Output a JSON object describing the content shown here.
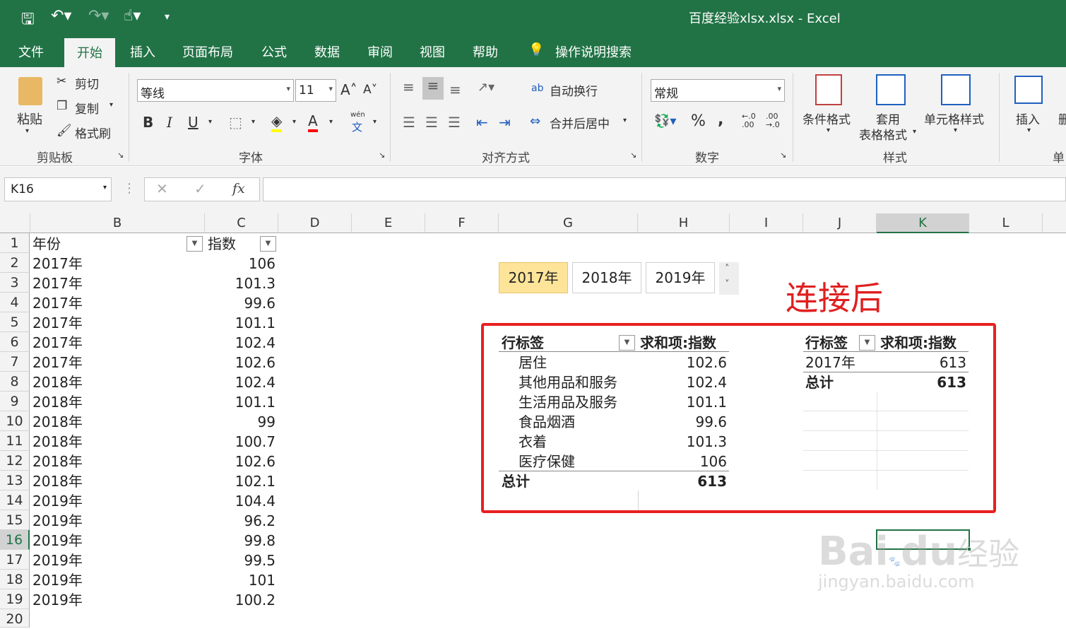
{
  "window": {
    "title": "百度经验xlsx.xlsx  -  Excel"
  },
  "tabs": [
    "文件",
    "开始",
    "插入",
    "页面布局",
    "公式",
    "数据",
    "审阅",
    "视图",
    "帮助"
  ],
  "tell_me": "操作说明搜索",
  "ribbon": {
    "paste": "粘贴",
    "cut": "剪切",
    "copy": "复制",
    "format_painter": "格式刷",
    "clipboard_group": "剪贴板",
    "font_name": "等线",
    "font_size": "11",
    "font_group": "字体",
    "bold": "B",
    "italic": "I",
    "underline": "U",
    "font_a": "A",
    "phonetic_top": "wén",
    "phonetic_bottom": "文",
    "wrap_text": "自动换行",
    "merge_center": "合并后居中",
    "alignment_group": "对齐方式",
    "number_format": "常规",
    "percent": "%",
    "comma": ",",
    "dec_inc": "←.0 .00",
    "dec_dec": ".00 →.0",
    "number_group": "数字",
    "conditional_format": "条件格式",
    "table_format_1": "套用",
    "table_format_2": "表格格式",
    "cell_styles": "单元格样式",
    "styles_group": "样式",
    "insert": "插入",
    "cells_group_partial": "单",
    "delete_partial": "删"
  },
  "formula_bar": {
    "name_box": "K16",
    "cancel": "✕",
    "enter": "✓",
    "fx": "fx",
    "content": ""
  },
  "columns": [
    "B",
    "C",
    "D",
    "E",
    "F",
    "G",
    "H",
    "I",
    "J",
    "K",
    "L"
  ],
  "rows": [
    "1",
    "2",
    "3",
    "4",
    "5",
    "6",
    "7",
    "8",
    "9",
    "10",
    "11",
    "12",
    "13",
    "14",
    "15",
    "16",
    "17",
    "18",
    "19",
    "20"
  ],
  "data_table": {
    "headers": [
      "年份",
      "指数"
    ],
    "rows": [
      [
        "2017年",
        "106"
      ],
      [
        "2017年",
        "101.3"
      ],
      [
        "2017年",
        "99.6"
      ],
      [
        "2017年",
        "101.1"
      ],
      [
        "2017年",
        "102.4"
      ],
      [
        "2017年",
        "102.6"
      ],
      [
        "2018年",
        "102.4"
      ],
      [
        "2018年",
        "101.1"
      ],
      [
        "2018年",
        "99"
      ],
      [
        "2018年",
        "100.7"
      ],
      [
        "2018年",
        "102.6"
      ],
      [
        "2018年",
        "102.1"
      ],
      [
        "2019年",
        "104.4"
      ],
      [
        "2019年",
        "96.2"
      ],
      [
        "2019年",
        "99.8"
      ],
      [
        "2019年",
        "99.5"
      ],
      [
        "2019年",
        "101"
      ],
      [
        "2019年",
        "100.2"
      ]
    ]
  },
  "slicer": {
    "items": [
      "2017年",
      "2018年",
      "2019年"
    ],
    "selected": "2017年"
  },
  "annotation": "连接后",
  "pivot1": {
    "header_label": "行标签",
    "header_value": "求和项:指数",
    "rows": [
      [
        "居住",
        "102.6"
      ],
      [
        "其他用品和服务",
        "102.4"
      ],
      [
        "生活用品及服务",
        "101.1"
      ],
      [
        "食品烟酒",
        "99.6"
      ],
      [
        "衣着",
        "101.3"
      ],
      [
        "医疗保健",
        "106"
      ]
    ],
    "total_label": "总计",
    "total_value": "613"
  },
  "pivot2": {
    "header_label": "行标签",
    "header_value": "求和项:指数",
    "rows": [
      [
        "2017年",
        "613"
      ]
    ],
    "total_label": "总计",
    "total_value": "613"
  },
  "watermark": {
    "line1": "Bai",
    "paw": "du",
    "cn": "经验",
    "line2": "jingyan.baidu.com"
  },
  "colors": {
    "excel_green": "#217346",
    "annotation_red": "#e02020",
    "slicer_selected": "#fde499"
  }
}
